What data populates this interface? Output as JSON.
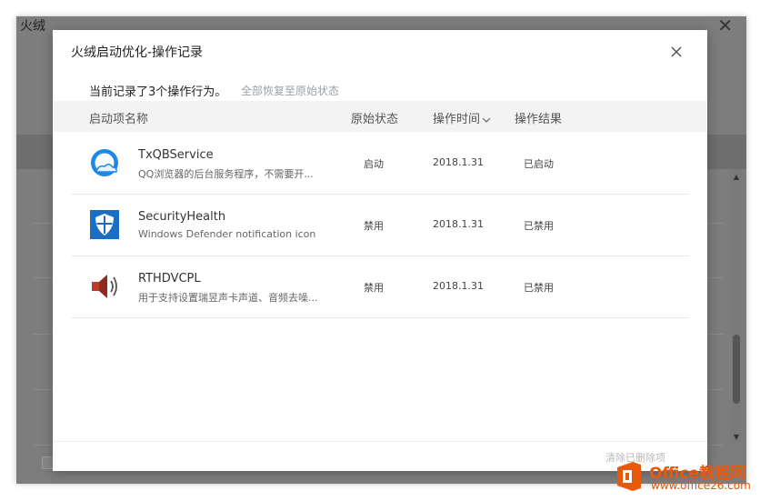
{
  "background_window": {
    "title": "火绒",
    "close_glyph": "✕"
  },
  "dialog": {
    "title": "火绒启动优化-操作记录",
    "summary": "当前记录了3个操作行为。",
    "restore_all": "全部恢复至原始状态",
    "columns": {
      "name": "启动项名称",
      "original": "原始状态",
      "time": "操作时间",
      "result": "操作结果"
    },
    "rows": [
      {
        "name": "TxQBService",
        "desc": "QQ浏览器的后台服务程序，不需要开...",
        "original": "启动",
        "time": "2018.1.31",
        "result": "已启动",
        "icon": "qq-browser-icon"
      },
      {
        "name": "SecurityHealth",
        "desc": "Windows Defender notification icon",
        "original": "禁用",
        "time": "2018.1.31",
        "result": "已禁用",
        "icon": "windows-defender-shield-icon"
      },
      {
        "name": "RTHDVCPL",
        "desc": "用于支持设置瑞昱声卡声道、音频去噪...",
        "original": "禁用",
        "time": "2018.1.31",
        "result": "已禁用",
        "icon": "speaker-icon"
      }
    ],
    "clear_removed": "清除已删除项"
  },
  "watermark": {
    "line1": "Office教程网",
    "line2": "www.office26.com"
  },
  "colors": {
    "link_gray": "#9aa0a8",
    "header_bg": "#f3f3f3",
    "brand_orange": "#e8590c",
    "defender_blue": "#1a6fc4"
  }
}
